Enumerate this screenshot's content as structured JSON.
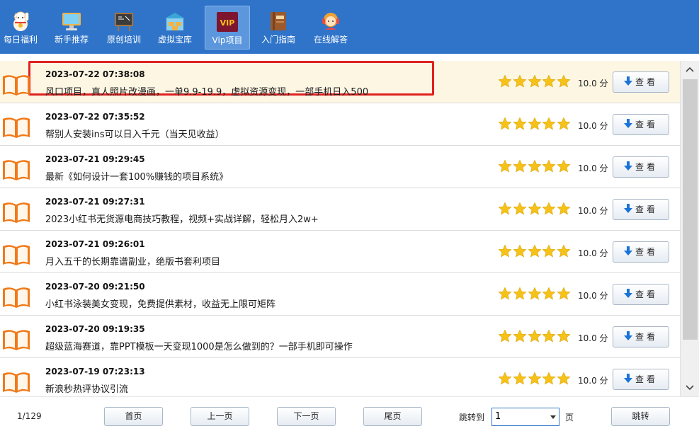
{
  "toolbar": {
    "items": [
      {
        "label": "每日福利",
        "icon": "lucky-cat-icon"
      },
      {
        "label": "新手推荐",
        "icon": "monitor-icon"
      },
      {
        "label": "原创培训",
        "icon": "chalkboard-icon"
      },
      {
        "label": "虚拟宝库",
        "icon": "warehouse-icon"
      },
      {
        "label": "Vip项目",
        "icon": "vip-icon",
        "badge": "VIP"
      },
      {
        "label": "入门指南",
        "icon": "guide-book-icon"
      },
      {
        "label": "在线解答",
        "icon": "support-agent-icon"
      }
    ]
  },
  "list": {
    "rows": [
      {
        "date": "2023-07-22 07:38:08",
        "title": "风口项目，真人照片改漫画，一单9.9-19.9，虚拟资源变现，一部手机日入500",
        "rating": 5,
        "score": "10.0 分",
        "button": "查看"
      },
      {
        "date": "2023-07-22 07:35:52",
        "title": "帮别人安装ins可以日入千元（当天见收益）",
        "rating": 5,
        "score": "10.0 分",
        "button": "查看"
      },
      {
        "date": "2023-07-21 09:29:45",
        "title": "最新《如何设计一套100%赚钱的项目系统》",
        "rating": 5,
        "score": "10.0 分",
        "button": "查看"
      },
      {
        "date": "2023-07-21 09:27:31",
        "title": "2023小红书无货源电商技巧教程，视频+实战详解，轻松月入2w+",
        "rating": 5,
        "score": "10.0 分",
        "button": "查看"
      },
      {
        "date": "2023-07-21 09:26:01",
        "title": "月入五千的长期靠谱副业，绝版书套利项目",
        "rating": 5,
        "score": "10.0 分",
        "button": "查看"
      },
      {
        "date": "2023-07-20 09:21:50",
        "title": "小红书泳装美女变现，免费提供素材，收益无上限可矩阵",
        "rating": 5,
        "score": "10.0 分",
        "button": "查看"
      },
      {
        "date": "2023-07-20 09:19:35",
        "title": "超级蓝海赛道，靠PPT模板一天变现1000是怎么做到的？一部手机即可操作",
        "rating": 5,
        "score": "10.0 分",
        "button": "查看"
      },
      {
        "date": "2023-07-19 07:23:13",
        "title": "新浪秒热评协议引流",
        "rating": 5,
        "score": "10.0 分",
        "button": "查看"
      }
    ]
  },
  "footer": {
    "page_info": "1/129",
    "first": "首页",
    "prev": "上一页",
    "next": "下一页",
    "last": "尾页",
    "jump_to": "跳转到",
    "page_value": "1",
    "page_unit": "页",
    "jump": "跳转"
  },
  "colors": {
    "toolbar_bg": "#2f74c9",
    "star": "#f6c21a",
    "highlight": "#e02020",
    "selected_row": "#fdf6e3",
    "book": "#f07a1a"
  }
}
